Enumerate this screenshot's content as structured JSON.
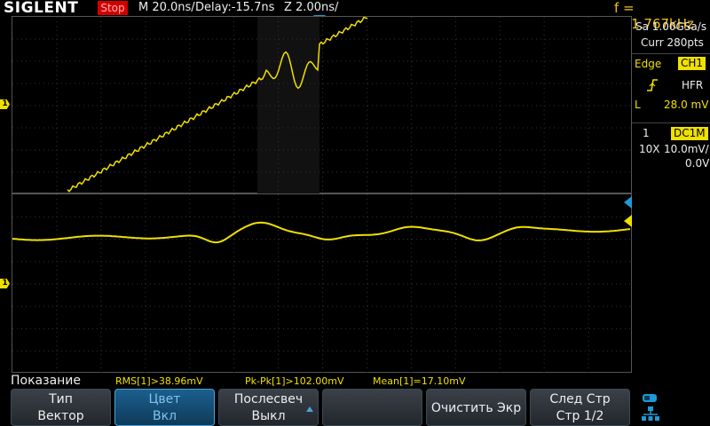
{
  "topbar": {
    "brand": "SIGLENT",
    "run_state": "Stop",
    "timebase": "M 20.0ns/",
    "delay": "Delay:-15.7ns",
    "zoom": "Z 2.00ns/",
    "frequency": "f = 571.767kHz"
  },
  "right_panel": {
    "sample_rate": "Sa 1.00GSa/s",
    "curr_points": "Curr 280pts",
    "trigger_label": "Edge",
    "trigger_source": "CH1",
    "coupling": "HFR",
    "level_label": "L",
    "level_value": "28.0 mV",
    "channel_number": "1",
    "channel_coupling": "DC1M",
    "probe": "10X",
    "volts_div": "10.0mV/",
    "offset": "0.0V"
  },
  "channel_markers": {
    "upper": "1",
    "lower": "1"
  },
  "measurements": {
    "label": "Показание",
    "rms": "RMS[1]>38.96mV",
    "pkpk": "Pk-Pk[1]>102.00mV",
    "mean": "Mean[1]=17.10mV"
  },
  "softkeys": [
    {
      "line1": "Тип",
      "line2": "Вектор"
    },
    {
      "line1": "Цвет",
      "line2": "Вкл"
    },
    {
      "line1": "Послесвеч",
      "line2": "Выкл"
    },
    {
      "line1": "",
      "line2": ""
    },
    {
      "line1": "Очистить Экр",
      "line2": ""
    },
    {
      "line1": "След Стр",
      "line2": "Стр 1/2"
    }
  ],
  "colors": {
    "channel1": "#f0e000",
    "trigger_marker": "#1e9ad6",
    "stop_badge": "#d00000",
    "active_key": "#1b5f8e"
  }
}
